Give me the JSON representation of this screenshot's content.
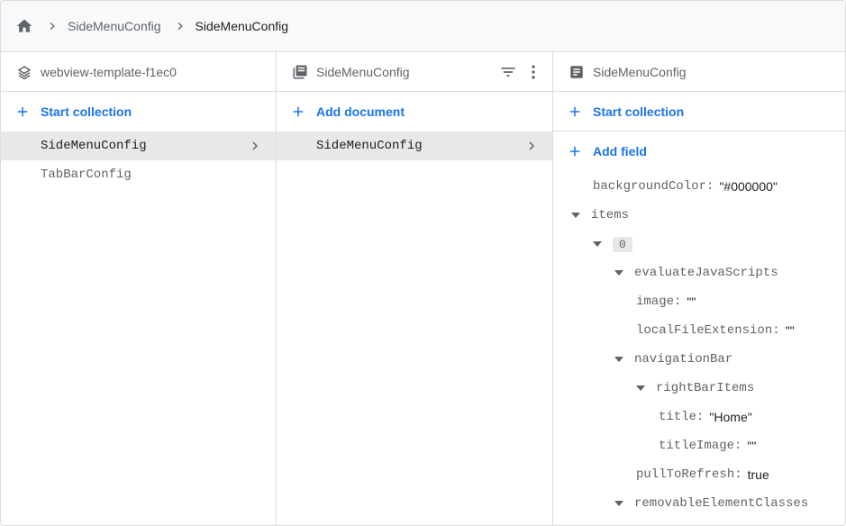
{
  "breadcrumb": {
    "home_icon": "home-icon",
    "items": [
      "SideMenuConfig",
      "SideMenuConfig"
    ]
  },
  "root_panel": {
    "title": "webview-template-f1ec0",
    "icon": "firestore-database-icon",
    "add_label": "Start collection",
    "items": [
      {
        "label": "SideMenuConfig",
        "selected": true
      },
      {
        "label": "TabBarConfig",
        "selected": false
      }
    ]
  },
  "collection_panel": {
    "title": "SideMenuConfig",
    "icon": "collection-icon",
    "add_label": "Add document",
    "items": [
      {
        "label": "SideMenuConfig",
        "selected": true
      }
    ]
  },
  "document_panel": {
    "title": "SideMenuConfig",
    "icon": "document-icon",
    "start_collection_label": "Start collection",
    "add_field_label": "Add field",
    "fields": {
      "backgroundColor": {
        "key": "backgroundColor",
        "value": "\"#000000\""
      },
      "items": {
        "key": "items"
      },
      "index0": {
        "key": "0"
      },
      "evaluateJavaScripts": {
        "key": "evaluateJavaScripts"
      },
      "image": {
        "key": "image",
        "value": "\"\""
      },
      "localFileExtension": {
        "key": "localFileExtension",
        "value": "\"\""
      },
      "navigationBar": {
        "key": "navigationBar"
      },
      "rightBarItems": {
        "key": "rightBarItems"
      },
      "title": {
        "key": "title",
        "value": "\"Home\""
      },
      "titleImage": {
        "key": "titleImage",
        "value": "\"\""
      },
      "pullToRefresh": {
        "key": "pullToRefresh",
        "value": "true"
      },
      "removableElementClasses": {
        "key": "removableElementClasses"
      }
    }
  },
  "colors": {
    "accent": "#1a73e8",
    "selected_row": "#e8e8e8",
    "border": "#dadce0",
    "muted_text": "#5f6368"
  }
}
